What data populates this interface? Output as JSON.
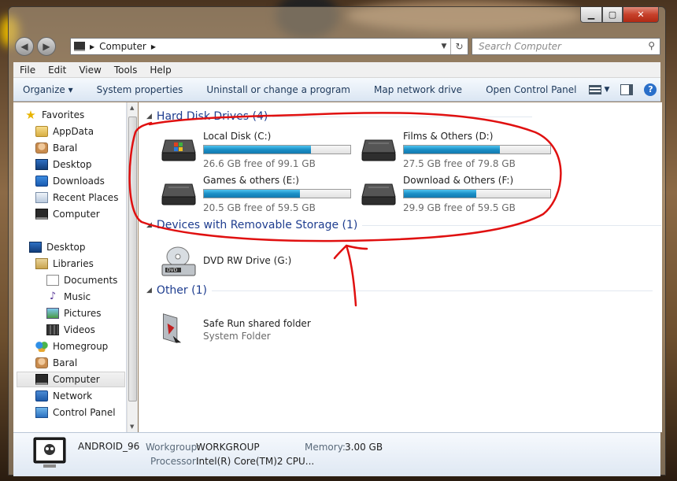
{
  "window": {
    "caption": {
      "minimize": "▁",
      "maximize": "▢",
      "close": "✕"
    }
  },
  "nav": {
    "back_icon": "◀",
    "forward_icon": "▶",
    "breadcrumb": [
      "Computer"
    ],
    "search_placeholder": "Search Computer"
  },
  "menu": [
    "File",
    "Edit",
    "View",
    "Tools",
    "Help"
  ],
  "commands": {
    "organize": "Organize ▾",
    "system_properties": "System properties",
    "uninstall": "Uninstall or change a program",
    "map_drive": "Map network drive",
    "control_panel": "Open Control Panel"
  },
  "sidebar": {
    "favorites": "Favorites",
    "fav_items": [
      "AppData",
      "Baral",
      "Desktop",
      "Downloads",
      "Recent Places",
      "Computer"
    ],
    "desktop": "Desktop",
    "libraries": "Libraries",
    "lib_items": [
      "Documents",
      "Music",
      "Pictures",
      "Videos"
    ],
    "homegroup": "Homegroup",
    "baral": "Baral",
    "computer": "Computer",
    "network": "Network",
    "control_panel": "Control Panel"
  },
  "groups": {
    "hdd": "Hard Disk Drives (4)",
    "removable": "Devices with Removable Storage (1)",
    "other": "Other (1)"
  },
  "drives": [
    {
      "name": "Local Disk (C:)",
      "free": "26.6 GB free of 99.1 GB",
      "used_fraction": 0.732
    },
    {
      "name": "Films & Others (D:)",
      "free": "27.5 GB free of 79.8 GB",
      "used_fraction": 0.655
    },
    {
      "name": "Games & others (E:)",
      "free": "20.5 GB free of 59.5 GB",
      "used_fraction": 0.655
    },
    {
      "name": "Download & Others (F:)",
      "free": "29.9 GB free of 59.5 GB",
      "used_fraction": 0.497
    }
  ],
  "removable": {
    "name": "DVD RW Drive (G:)",
    "icon_label": "DVD"
  },
  "other": {
    "name": "Safe Run shared folder",
    "type": "System Folder"
  },
  "details": {
    "computer_name": "ANDROID_96",
    "workgroup_label": "Workgroup:",
    "workgroup": "WORKGROUP",
    "memory_label": "Memory:",
    "memory": "3.00 GB",
    "processor_label": "Processor:",
    "processor": "Intel(R) Core(TM)2 CPU..."
  },
  "colors": {
    "annotation": "#e01010",
    "progress": "#1b8fc6",
    "group_header": "#1e3d8f"
  }
}
